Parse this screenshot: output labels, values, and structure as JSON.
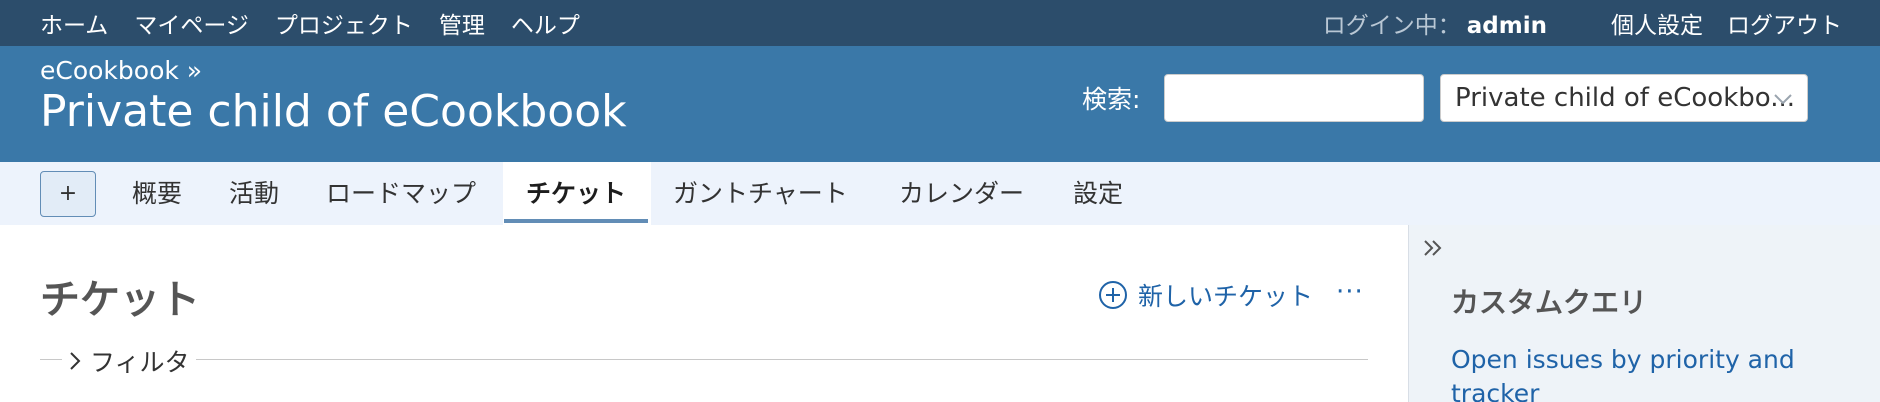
{
  "top_menu": {
    "items": [
      "ホーム",
      "マイページ",
      "プロジェクト",
      "管理",
      "ヘルプ"
    ],
    "logged_as_label": "ログイン中：",
    "user": "admin",
    "my_account": "個人設定",
    "logout": "ログアウト"
  },
  "header": {
    "breadcrumb": "eCookbook »",
    "title": "Private child of eCookbook",
    "search_label": "検索:",
    "search_value": "",
    "project_jump": "Private child of eCookbo..."
  },
  "main_menu": {
    "new_label": "+",
    "tabs": [
      "概要",
      "活動",
      "ロードマップ",
      "チケット",
      "ガントチャート",
      "カレンダー",
      "設定"
    ],
    "selected": "チケット"
  },
  "content": {
    "heading": "チケット",
    "new_issue": "新しいチケット",
    "more": "···",
    "filter_label": "フィルタ"
  },
  "sidebar": {
    "heading": "カスタムクエリ",
    "queries": [
      "Open issues by priority and tracker"
    ]
  },
  "colors": {
    "topbar": "#2c4d6b",
    "header": "#3a78a8",
    "menu_bg": "#edf3fc",
    "link": "#1f63a8",
    "accent": "#628db6"
  }
}
